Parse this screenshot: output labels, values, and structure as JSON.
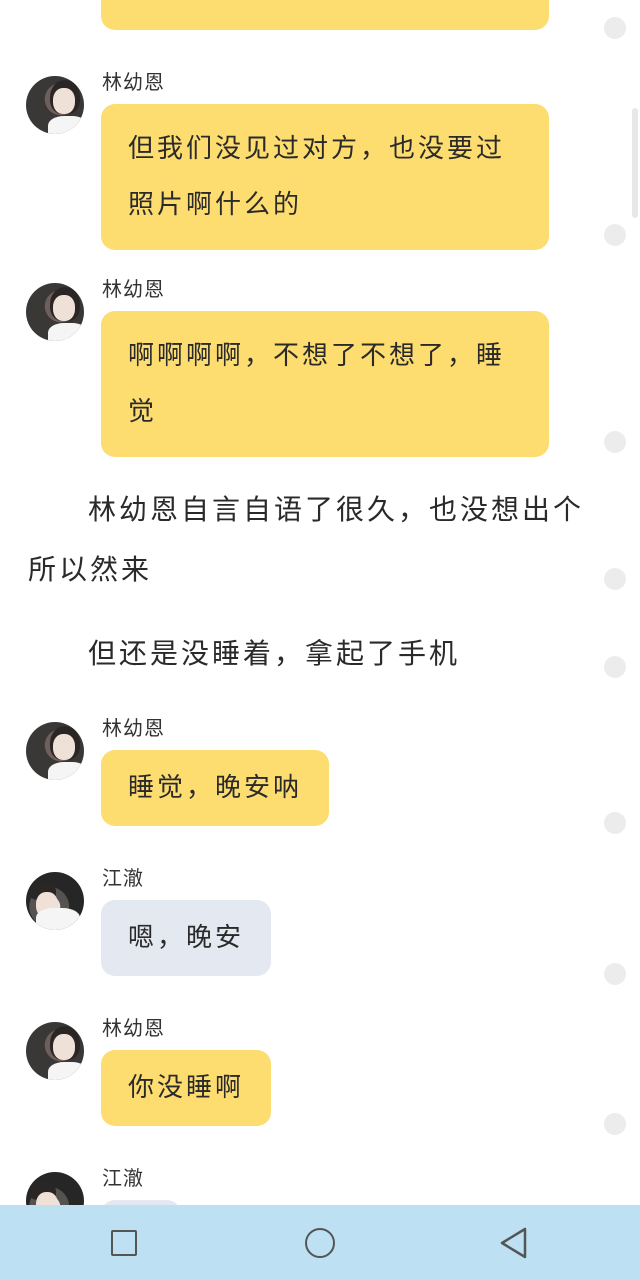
{
  "partial_top_bubble": "",
  "messages": [
    {
      "sender": "林幼恩",
      "lines": [
        "但我们没见过对方，也没要过",
        "照片啊什么的"
      ],
      "style": "yellow"
    },
    {
      "sender": "林幼恩",
      "lines": [
        "啊啊啊啊，不想了不想了，睡",
        "觉"
      ],
      "style": "yellow"
    },
    {
      "sender": "林幼恩",
      "text": "睡觉，晚安呐",
      "style": "yellow"
    },
    {
      "sender": "江澈",
      "text": "嗯，晚安",
      "style": "gray"
    },
    {
      "sender": "林幼恩",
      "text": "你没睡啊",
      "style": "yellow"
    },
    {
      "sender": "江澈",
      "text": "",
      "style": "gray"
    }
  ],
  "narration": {
    "p1_line1": "林幼恩自言自语了很久，也没想出个",
    "p1_line2": "所以然来",
    "p2": "但还是没睡着，拿起了手机"
  },
  "navbar": {
    "recent_icon": "square-icon",
    "home_icon": "circle-icon",
    "back_icon": "triangle-back-icon"
  },
  "colors": {
    "her_bubble": "#fddd70",
    "his_bubble": "#e3e8f1",
    "navbar": "#bde0f3"
  }
}
